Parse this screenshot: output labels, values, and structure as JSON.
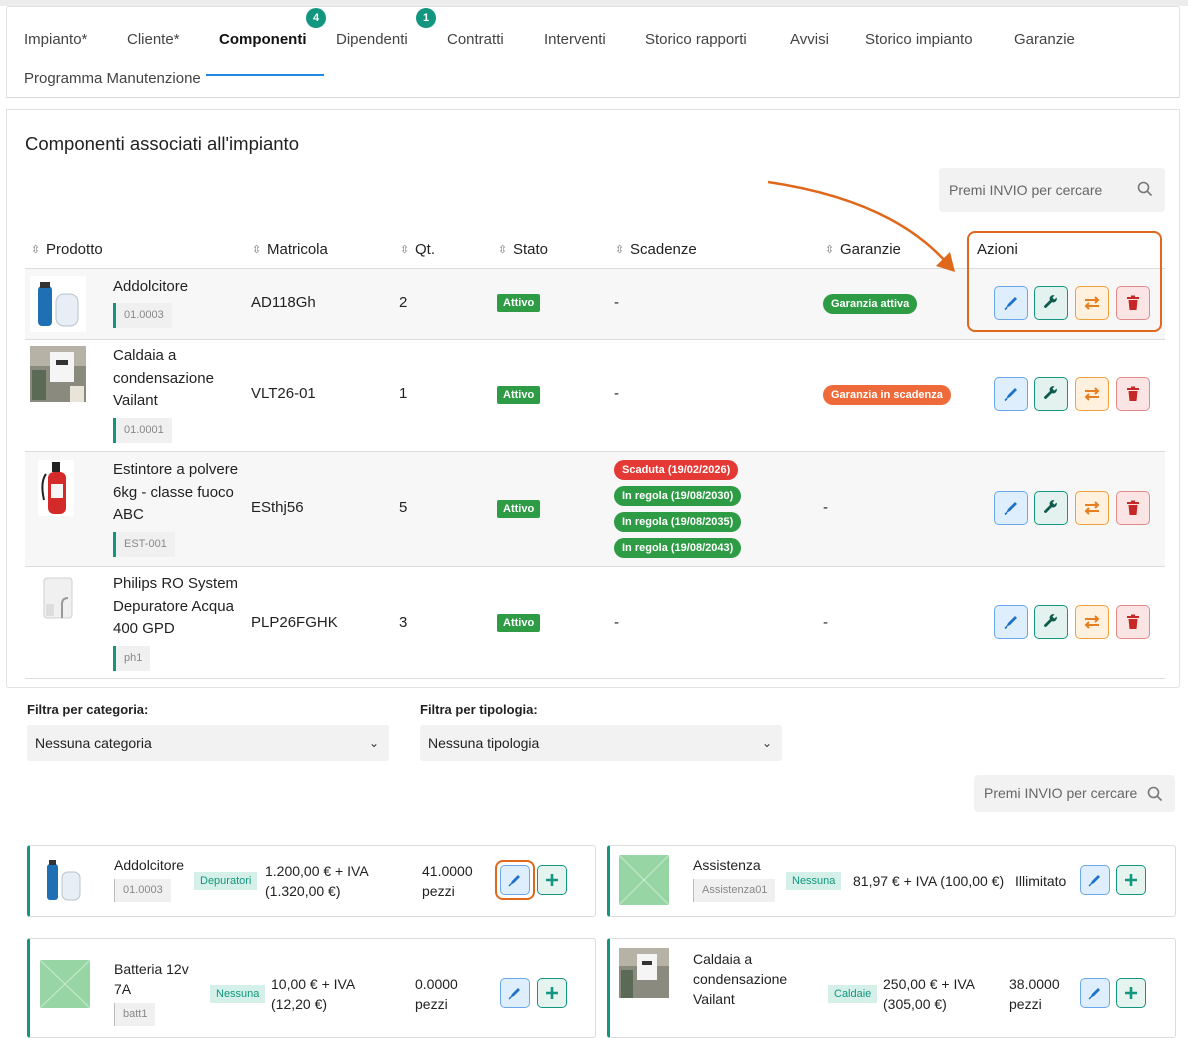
{
  "tabs": [
    {
      "label": "Impianto*"
    },
    {
      "label": "Cliente*"
    },
    {
      "label": "Componenti",
      "badge": "4"
    },
    {
      "label": "Dipendenti",
      "badge": "1"
    },
    {
      "label": "Contratti"
    },
    {
      "label": "Interventi"
    },
    {
      "label": "Storico rapporti"
    },
    {
      "label": "Avvisi"
    },
    {
      "label": "Storico impianto"
    },
    {
      "label": "Garanzie"
    },
    {
      "label": "Programma Manutenzione"
    }
  ],
  "section_title": "Componenti associati all'impianto",
  "search_placeholder": "Premi INVIO per cercare",
  "columns": [
    "Prodotto",
    "Matricola",
    "Qt.",
    "Stato",
    "Scadenze",
    "Garanzie",
    "Azioni"
  ],
  "rows": [
    {
      "name": "Addolcitore",
      "code": "01.0003",
      "matricola": "AD118Gh",
      "qty": "2",
      "stato": "Attivo",
      "scadenze": [
        "-"
      ],
      "garanzia": "Garanzia attiva",
      "garanzia_color": "#2e9b45"
    },
    {
      "name": "Caldaia a condensazione Vailant",
      "code": "01.0001",
      "matricola": "VLT26-01",
      "qty": "1",
      "stato": "Attivo",
      "scadenze": [
        "-"
      ],
      "garanzia": "Garanzia in scadenza",
      "garanzia_color": "#ef6a3a"
    },
    {
      "name": "Estintore a polvere 6kg - classe fuoco ABC",
      "code": "EST-001",
      "matricola": "ESthj56",
      "qty": "5",
      "stato": "Attivo",
      "scadenze": [
        "Scaduta (19/02/2026)",
        "In regola (19/08/2030)",
        "In regola (19/08/2035)",
        "In regola (19/08/2043)"
      ],
      "garanzia": "-"
    },
    {
      "name": "Philips RO System Depuratore Acqua 400 GPD",
      "code": "ph1",
      "matricola": "PLP26FGHK",
      "qty": "3",
      "stato": "Attivo",
      "scadenze": [
        "-"
      ],
      "garanzia": "-"
    }
  ],
  "filters": {
    "categoria_label": "Filtra per categoria:",
    "categoria_value": "Nessuna categoria",
    "tipologia_label": "Filtra per tipologia:",
    "tipologia_value": "Nessuna tipologia",
    "search_placeholder": "Premi INVIO per cercare"
  },
  "products": [
    {
      "name": "Addolcitore",
      "code": "01.0003",
      "category": "Depuratori",
      "price": "1.200,00 € + IVA",
      "price_iva": "(1.320,00 €)",
      "stock": "41.0000",
      "unit": "pezzi"
    },
    {
      "name": "Assistenza",
      "code": "Assistenza01",
      "category": "Nessuna",
      "price": "81,97 € + IVA (100,00 €)",
      "stock": "Illimitato"
    },
    {
      "name": "Batteria 12v 7A",
      "code": "batt1",
      "category": "Nessuna",
      "price": "10,00 € + IVA",
      "price_iva": "(12,20 €)",
      "stock": "0.0000",
      "unit": "pezzi"
    },
    {
      "name": "Caldaia a condensazione Vailant",
      "code": "01.0001",
      "category": "Caldaie",
      "price": "250,00 € + IVA",
      "price_iva": "(305,00 €)",
      "stock": "38.0000",
      "unit": "pezzi"
    }
  ],
  "colors": {
    "accent": "#13967f",
    "active_tab": "#1e88e5",
    "highlight": "#e0681c"
  }
}
